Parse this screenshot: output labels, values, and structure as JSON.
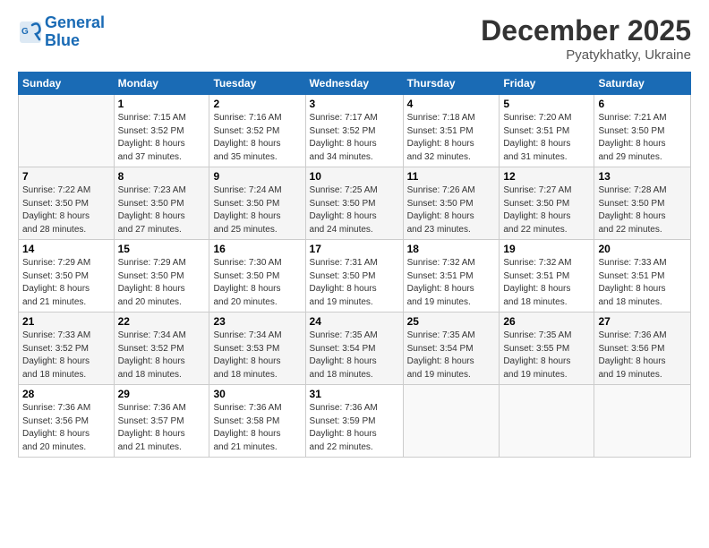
{
  "header": {
    "logo_line1": "General",
    "logo_line2": "Blue",
    "title": "December 2025",
    "subtitle": "Pyatykhatky, Ukraine"
  },
  "days_of_week": [
    "Sunday",
    "Monday",
    "Tuesday",
    "Wednesday",
    "Thursday",
    "Friday",
    "Saturday"
  ],
  "weeks": [
    [
      {
        "day": "",
        "info": ""
      },
      {
        "day": "1",
        "info": "Sunrise: 7:15 AM\nSunset: 3:52 PM\nDaylight: 8 hours\nand 37 minutes."
      },
      {
        "day": "2",
        "info": "Sunrise: 7:16 AM\nSunset: 3:52 PM\nDaylight: 8 hours\nand 35 minutes."
      },
      {
        "day": "3",
        "info": "Sunrise: 7:17 AM\nSunset: 3:52 PM\nDaylight: 8 hours\nand 34 minutes."
      },
      {
        "day": "4",
        "info": "Sunrise: 7:18 AM\nSunset: 3:51 PM\nDaylight: 8 hours\nand 32 minutes."
      },
      {
        "day": "5",
        "info": "Sunrise: 7:20 AM\nSunset: 3:51 PM\nDaylight: 8 hours\nand 31 minutes."
      },
      {
        "day": "6",
        "info": "Sunrise: 7:21 AM\nSunset: 3:50 PM\nDaylight: 8 hours\nand 29 minutes."
      }
    ],
    [
      {
        "day": "7",
        "info": "Sunrise: 7:22 AM\nSunset: 3:50 PM\nDaylight: 8 hours\nand 28 minutes."
      },
      {
        "day": "8",
        "info": "Sunrise: 7:23 AM\nSunset: 3:50 PM\nDaylight: 8 hours\nand 27 minutes."
      },
      {
        "day": "9",
        "info": "Sunrise: 7:24 AM\nSunset: 3:50 PM\nDaylight: 8 hours\nand 25 minutes."
      },
      {
        "day": "10",
        "info": "Sunrise: 7:25 AM\nSunset: 3:50 PM\nDaylight: 8 hours\nand 24 minutes."
      },
      {
        "day": "11",
        "info": "Sunrise: 7:26 AM\nSunset: 3:50 PM\nDaylight: 8 hours\nand 23 minutes."
      },
      {
        "day": "12",
        "info": "Sunrise: 7:27 AM\nSunset: 3:50 PM\nDaylight: 8 hours\nand 22 minutes."
      },
      {
        "day": "13",
        "info": "Sunrise: 7:28 AM\nSunset: 3:50 PM\nDaylight: 8 hours\nand 22 minutes."
      }
    ],
    [
      {
        "day": "14",
        "info": "Sunrise: 7:29 AM\nSunset: 3:50 PM\nDaylight: 8 hours\nand 21 minutes."
      },
      {
        "day": "15",
        "info": "Sunrise: 7:29 AM\nSunset: 3:50 PM\nDaylight: 8 hours\nand 20 minutes."
      },
      {
        "day": "16",
        "info": "Sunrise: 7:30 AM\nSunset: 3:50 PM\nDaylight: 8 hours\nand 20 minutes."
      },
      {
        "day": "17",
        "info": "Sunrise: 7:31 AM\nSunset: 3:50 PM\nDaylight: 8 hours\nand 19 minutes."
      },
      {
        "day": "18",
        "info": "Sunrise: 7:32 AM\nSunset: 3:51 PM\nDaylight: 8 hours\nand 19 minutes."
      },
      {
        "day": "19",
        "info": "Sunrise: 7:32 AM\nSunset: 3:51 PM\nDaylight: 8 hours\nand 18 minutes."
      },
      {
        "day": "20",
        "info": "Sunrise: 7:33 AM\nSunset: 3:51 PM\nDaylight: 8 hours\nand 18 minutes."
      }
    ],
    [
      {
        "day": "21",
        "info": "Sunrise: 7:33 AM\nSunset: 3:52 PM\nDaylight: 8 hours\nand 18 minutes."
      },
      {
        "day": "22",
        "info": "Sunrise: 7:34 AM\nSunset: 3:52 PM\nDaylight: 8 hours\nand 18 minutes."
      },
      {
        "day": "23",
        "info": "Sunrise: 7:34 AM\nSunset: 3:53 PM\nDaylight: 8 hours\nand 18 minutes."
      },
      {
        "day": "24",
        "info": "Sunrise: 7:35 AM\nSunset: 3:54 PM\nDaylight: 8 hours\nand 18 minutes."
      },
      {
        "day": "25",
        "info": "Sunrise: 7:35 AM\nSunset: 3:54 PM\nDaylight: 8 hours\nand 19 minutes."
      },
      {
        "day": "26",
        "info": "Sunrise: 7:35 AM\nSunset: 3:55 PM\nDaylight: 8 hours\nand 19 minutes."
      },
      {
        "day": "27",
        "info": "Sunrise: 7:36 AM\nSunset: 3:56 PM\nDaylight: 8 hours\nand 19 minutes."
      }
    ],
    [
      {
        "day": "28",
        "info": "Sunrise: 7:36 AM\nSunset: 3:56 PM\nDaylight: 8 hours\nand 20 minutes."
      },
      {
        "day": "29",
        "info": "Sunrise: 7:36 AM\nSunset: 3:57 PM\nDaylight: 8 hours\nand 21 minutes."
      },
      {
        "day": "30",
        "info": "Sunrise: 7:36 AM\nSunset: 3:58 PM\nDaylight: 8 hours\nand 21 minutes."
      },
      {
        "day": "31",
        "info": "Sunrise: 7:36 AM\nSunset: 3:59 PM\nDaylight: 8 hours\nand 22 minutes."
      },
      {
        "day": "",
        "info": ""
      },
      {
        "day": "",
        "info": ""
      },
      {
        "day": "",
        "info": ""
      }
    ]
  ]
}
